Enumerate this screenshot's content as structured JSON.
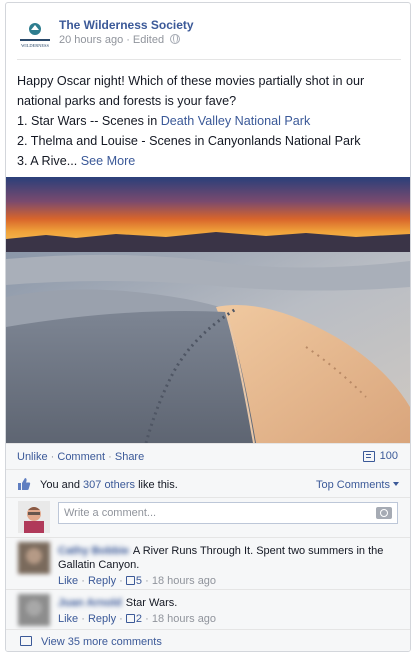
{
  "post": {
    "page_name": "The Wilderness Society",
    "timestamp": "20 hours ago",
    "edited_label": "Edited",
    "text_line1": "Happy Oscar night! Which of these movies partially shot in our",
    "text_line2": "national parks and forests is your fave?",
    "text_line3_prefix": "1. Star Wars -- Scenes in ",
    "text_line3_link": "Death Valley National Park",
    "text_line4": "2. Thelma and Louise - Scenes in Canyonlands National Park",
    "text_line5_prefix": "3. A Rive... ",
    "see_more": "See More",
    "logo_text": "WILDERNESS"
  },
  "actions": {
    "unlike": "Unlike",
    "comment": "Comment",
    "share": "Share",
    "separator": "·",
    "comment_count": "100"
  },
  "likes": {
    "you_and": "You and ",
    "others_link": "307 others",
    "like_this": " like this.",
    "sort_label": "Top Comments"
  },
  "composer": {
    "placeholder": "Write a comment..."
  },
  "comments": [
    {
      "author": "Cathy Bobbie",
      "text": "A River Runs Through It. Spent two summers in the Gallatin Canyon.",
      "like": "Like",
      "reply": "Reply",
      "likes": "5",
      "time": "18 hours ago"
    },
    {
      "author": "Juan Arnold",
      "text": "Star Wars.",
      "like": "Like",
      "reply": "Reply",
      "likes": "2",
      "time": "18 hours ago"
    }
  ],
  "view_more": "View 35 more comments",
  "colors": {
    "link": "#3b5998",
    "meta": "#90949c",
    "bg_ufi": "#f6f7f8"
  }
}
